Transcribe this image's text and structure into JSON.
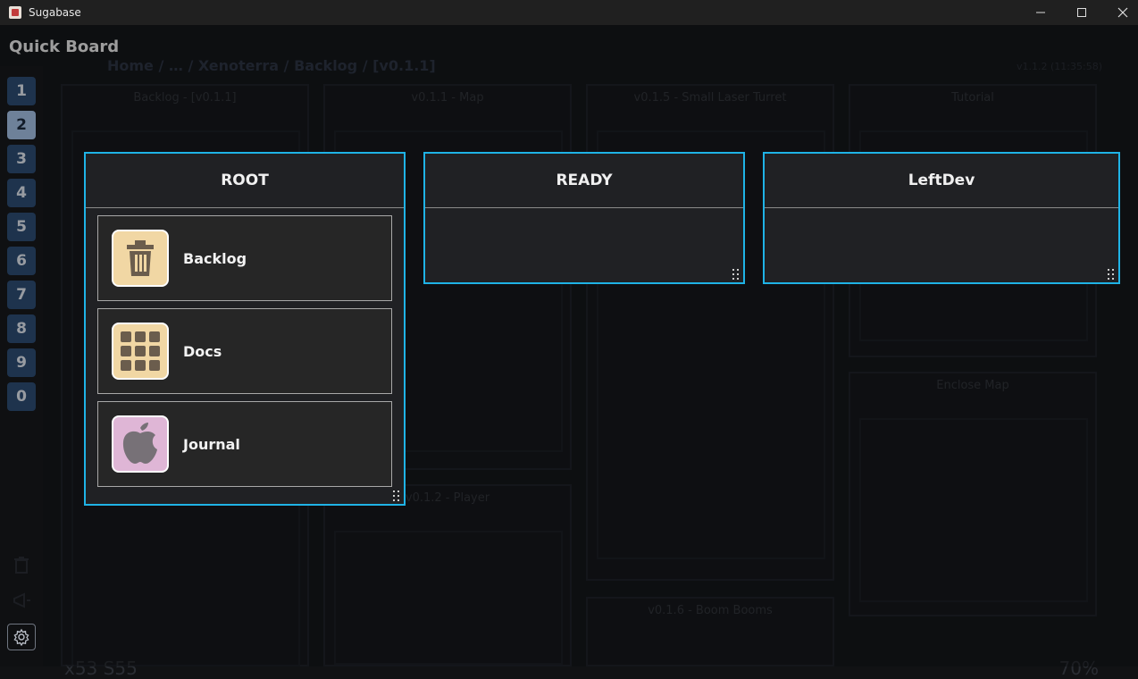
{
  "window": {
    "title": "Sugabase",
    "minimize": "—",
    "maximize": "☐",
    "close": "✕"
  },
  "background": {
    "breadcrumb": "Home / … / Xenoterra / Backlog / [v0.1.1]",
    "version": "v1.1.2 (11:35:58)",
    "columns": [
      "Backlog - [v0.1.1]",
      "v0.1.1 - Map",
      "v0.1.5 - Small Laser Turret",
      "Tutorial",
      "v0.1.2 - Player",
      "Enclose Map",
      "v0.1.6 - Boom Booms"
    ],
    "bottom_left": "x53 S55",
    "zoom": "70%"
  },
  "header": {
    "title": "Quick Board"
  },
  "sidebar": {
    "numbers": [
      "1",
      "2",
      "3",
      "4",
      "5",
      "6",
      "7",
      "8",
      "9",
      "0"
    ],
    "active_index": 1,
    "icons": [
      "trash-icon",
      "megaphone-icon",
      "gear-icon"
    ]
  },
  "panels": [
    {
      "title": "ROOT",
      "items": [
        {
          "label": "Backlog",
          "icon": "trash-icon",
          "color": "#f1d7a4"
        },
        {
          "label": "Docs",
          "icon": "grid-icon",
          "color": "#f1d7a4"
        },
        {
          "label": "Journal",
          "icon": "apple-icon",
          "color": "#dfb6d6"
        }
      ]
    },
    {
      "title": "READY",
      "items": []
    },
    {
      "title": "LeftDev",
      "items": []
    }
  ],
  "colors": {
    "accent_border": "#1fb3e6",
    "number_button": "#2f4f77",
    "number_button_active": "#a9c7ec"
  }
}
